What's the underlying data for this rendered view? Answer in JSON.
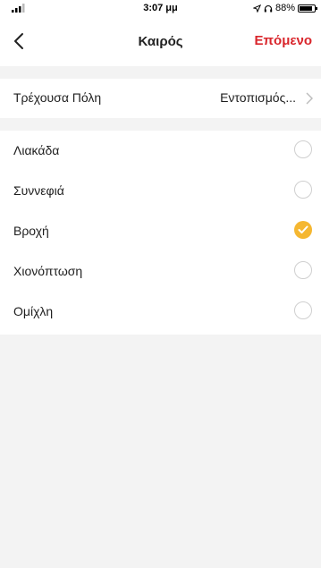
{
  "status_bar": {
    "time": "3:07 μμ",
    "battery": "88%",
    "battery_level": 0.88,
    "icons": [
      "signal-icon",
      "location-arrow-icon",
      "headphones-icon",
      "battery-icon"
    ]
  },
  "nav": {
    "title": "Καιρός",
    "next_label": "Επόμενο",
    "back_icon": "chevron-left-icon"
  },
  "city": {
    "label": "Τρέχουσα Πόλη",
    "value": "Εντοπισμός...",
    "icon": "chevron-right-icon"
  },
  "weather_options": [
    {
      "label": "Λιακάδα",
      "selected": false
    },
    {
      "label": "Συννεφιά",
      "selected": false
    },
    {
      "label": "Βροχή",
      "selected": true
    },
    {
      "label": "Χιονόπτωση",
      "selected": false
    },
    {
      "label": "Ομίχλη",
      "selected": false
    }
  ],
  "colors": {
    "accent_red": "#d9262c",
    "check_yellow": "#f5b731",
    "background": "#f3f3f3"
  }
}
